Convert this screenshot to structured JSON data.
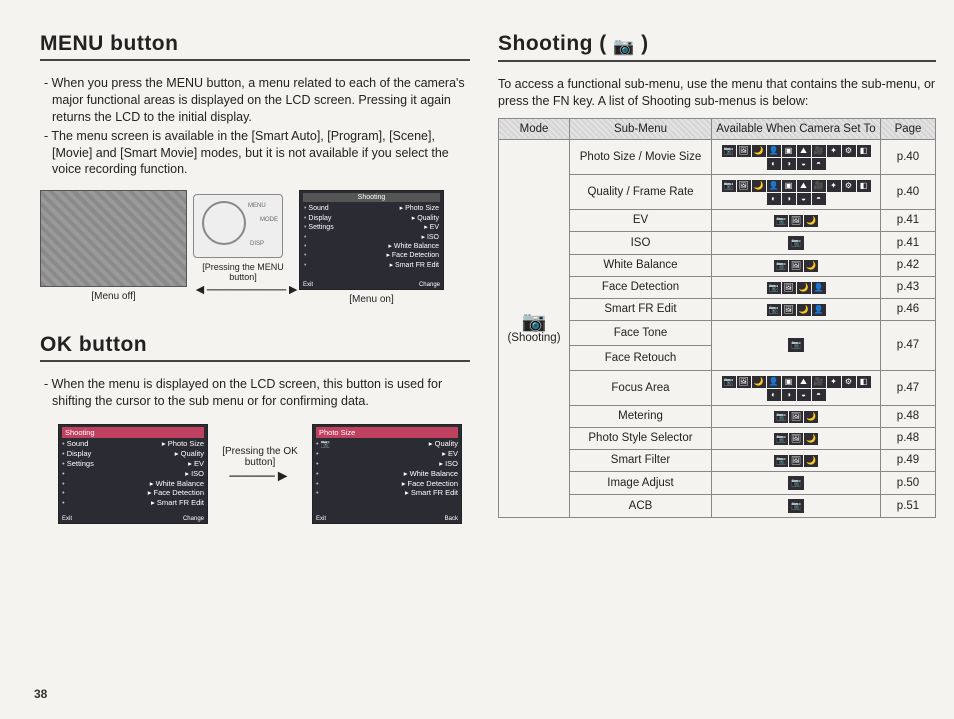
{
  "page_number": "38",
  "left": {
    "section1_title": "MENU button",
    "section1_p1": "- When you press the MENU button, a menu related to each of the camera's major functional areas is displayed on the LCD screen. Pressing it again returns the LCD to the initial display.",
    "section1_p2": "- The menu screen is available in the [Smart Auto], [Program], [Scene], [Movie] and [Smart Movie] modes, but it is not available if you select the voice recording function.",
    "fig1": {
      "left_caption": "[Menu off]",
      "press_label": "[Pressing the MENU button]",
      "right_caption": "[Menu on]",
      "camera_labels": {
        "menu": "MENU",
        "mode": "MODE",
        "disp": "DISP"
      },
      "panel": {
        "header": "Shooting",
        "left_items": [
          "Sound",
          "Display",
          "Settings"
        ],
        "right_items": [
          "Photo Size",
          "Quality",
          "EV",
          "ISO",
          "White Balance",
          "Face Detection",
          "Smart FR Edit"
        ],
        "foot_left": "Exit",
        "foot_right": "Change"
      }
    },
    "section2_title": "OK button",
    "section2_p1": "- When the menu is displayed on the LCD screen, this button is used for shifting the cursor to the sub menu or for confirming data.",
    "fig2": {
      "press_label": "[Pressing the OK button]",
      "panelA": {
        "header": "Shooting",
        "left_items": [
          "Sound",
          "Display",
          "Settings"
        ],
        "right_items": [
          "Photo Size",
          "Quality",
          "EV",
          "ISO",
          "White Balance",
          "Face Detection",
          "Smart FR Edit"
        ],
        "foot_left": "Exit",
        "foot_right": "Change"
      },
      "panelB": {
        "header": "Photo Size",
        "right_items": [
          "Quality",
          "EV",
          "ISO",
          "White Balance",
          "Face Detection",
          "Smart FR Edit"
        ],
        "foot_left": "Exit",
        "foot_right": "Back"
      }
    }
  },
  "right": {
    "title_prefix": "Shooting ( ",
    "title_suffix": " )",
    "intro": "To access a functional sub-menu, use the menu that contains the sub-menu, or press the FN key. A list of Shooting sub-menus is below:",
    "headers": {
      "mode": "Mode",
      "sub": "Sub-Menu",
      "avail": "Available When Camera Set To",
      "page": "Page"
    },
    "mode_label": "(Shooting)",
    "rows": [
      {
        "sub": "Photo Size / Movie Size",
        "icons": 14,
        "page": "p.40"
      },
      {
        "sub": "Quality / Frame Rate",
        "icons": 14,
        "page": "p.40"
      },
      {
        "sub": "EV",
        "icons": 3,
        "page": "p.41"
      },
      {
        "sub": "ISO",
        "icons": 1,
        "page": "p.41"
      },
      {
        "sub": "White Balance",
        "icons": 3,
        "page": "p.42"
      },
      {
        "sub": "Face Detection",
        "icons": 4,
        "page": "p.43"
      },
      {
        "sub": "Smart FR Edit",
        "icons": 4,
        "page": "p.46"
      },
      {
        "sub": "Face Tone",
        "split_next": "Face Retouch",
        "icons": 1,
        "page": "p.47"
      },
      {
        "sub": "Focus Area",
        "icons": 14,
        "page": "p.47"
      },
      {
        "sub": "Metering",
        "icons": 3,
        "page": "p.48"
      },
      {
        "sub": "Photo Style Selector",
        "icons": 3,
        "page": "p.48"
      },
      {
        "sub": "Smart Filter",
        "icons": 3,
        "page": "p.49"
      },
      {
        "sub": "Image Adjust",
        "icons": 1,
        "page": "p.50"
      },
      {
        "sub": "ACB",
        "icons": 1,
        "page": "p.51"
      }
    ]
  }
}
